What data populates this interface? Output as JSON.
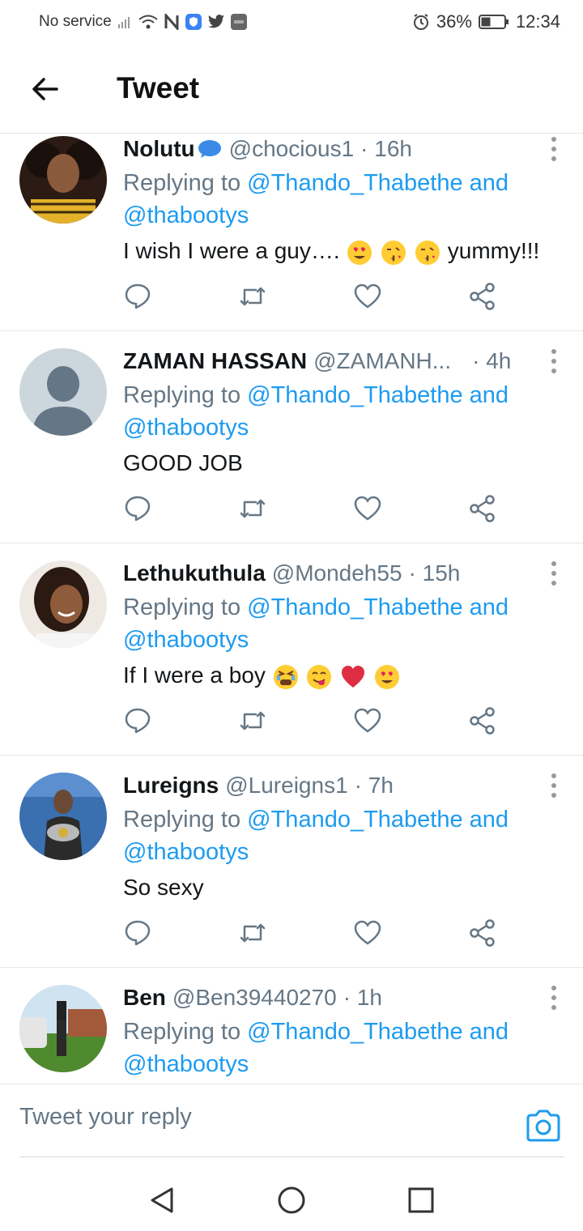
{
  "status_bar": {
    "carrier": "No service",
    "battery": "36%",
    "time": "12:34",
    "icons": [
      "signal-icon",
      "wifi-icon",
      "nfc-icon",
      "vpn-shield-icon",
      "twitter-bird-icon",
      "hms-icon",
      "alarm-icon",
      "battery-icon"
    ]
  },
  "header": {
    "title": "Tweet",
    "back_icon": "arrow-left-icon"
  },
  "colors": {
    "accent": "#1d9bf0",
    "muted": "#657786",
    "divider": "#e1e8ed"
  },
  "tweets": [
    {
      "name": "Nolutu",
      "name_emoji": "speech-bubble-emoji",
      "handle": "@chocious1",
      "time": "· 16h",
      "replying_prefix": "Replying to ",
      "mention_1": "@Thando_Thabethe and",
      "mention_2": "@thabootys",
      "text": "I wish I were a guy….",
      "text_suffix": "yummy!!!",
      "emojis": [
        "heart-eyes-emoji",
        "kiss-emoji",
        "kiss-emoji"
      ]
    },
    {
      "name": "ZAMAN HASSAN",
      "handle": "@ZAMANH...",
      "time": "· 4h",
      "replying_prefix": "Replying to ",
      "mention_1": "@Thando_Thabethe and",
      "mention_2": "@thabootys",
      "text": "GOOD JOB"
    },
    {
      "name": "Lethukuthula",
      "handle": "@Mondeh55",
      "time": "· 15h",
      "replying_prefix": "Replying to ",
      "mention_1": "@Thando_Thabethe and",
      "mention_2": "@thabootys",
      "text": "If I were a boy",
      "emojis": [
        "tired-face-emoji",
        "yum-face-emoji",
        "red-heart-emoji",
        "heart-eyes-emoji"
      ]
    },
    {
      "name": "Lureigns",
      "handle": "@Lureigns1",
      "time": "· 7h",
      "replying_prefix": "Replying to ",
      "mention_1": "@Thando_Thabethe and",
      "mention_2": "@thabootys",
      "text": "So sexy"
    },
    {
      "name": "Ben",
      "handle": "@Ben39440270",
      "time": "· 1h",
      "replying_prefix": "Replying to ",
      "mention_1": "@Thando_Thabethe and",
      "mention_2": "@thabootys"
    }
  ],
  "composer": {
    "placeholder": "Tweet your reply",
    "camera_icon": "camera-icon"
  },
  "nav": {
    "icons": [
      "nav-back-icon",
      "nav-home-icon",
      "nav-recents-icon"
    ]
  }
}
